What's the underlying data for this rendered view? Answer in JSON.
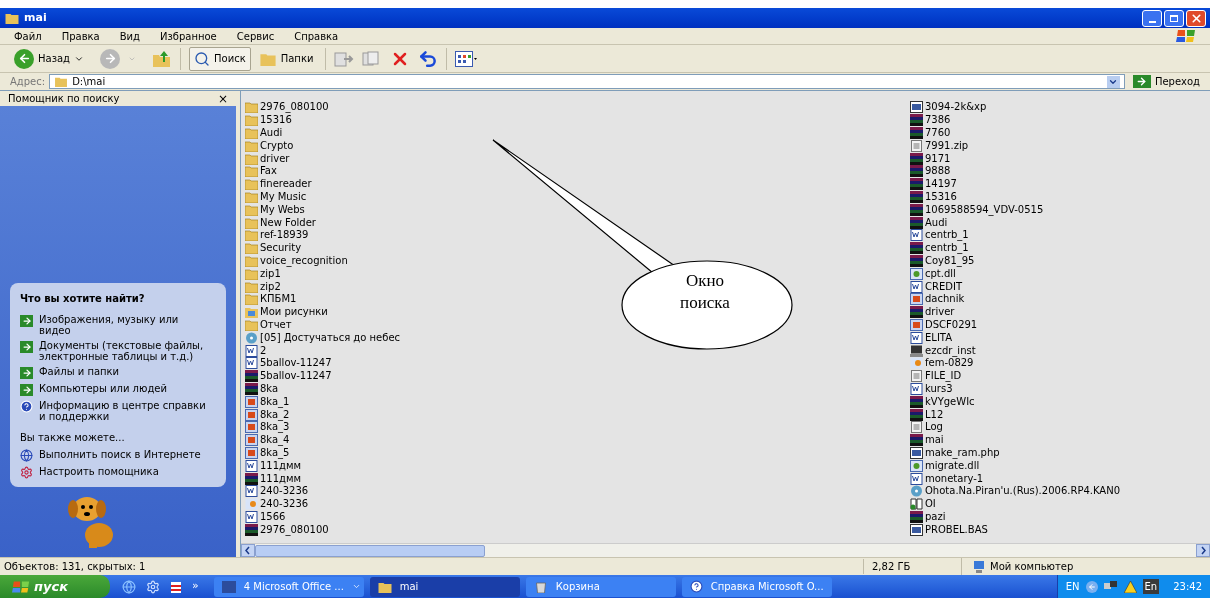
{
  "window": {
    "title": "mai"
  },
  "menu": [
    "Файл",
    "Правка",
    "Вид",
    "Избранное",
    "Сервис",
    "Справка"
  ],
  "toolbar": {
    "back": "Назад",
    "search": {
      "label": "Поиск",
      "selected": true
    },
    "folders": {
      "label": "Папки",
      "selected": false
    }
  },
  "address": {
    "label": "Адрес:",
    "value": "D:\\mai",
    "go": "Переход"
  },
  "search_pane": {
    "title": "Помощник по поиску",
    "close": "×",
    "heading": "Что вы хотите найти?",
    "options": [
      {
        "kind": "arrow",
        "label": "Изображения, музыку или видео"
      },
      {
        "kind": "arrow",
        "label": "Документы (текстовые файлы, электронные таблицы и т.д.)"
      },
      {
        "kind": "arrow",
        "label": "Файлы и папки"
      },
      {
        "kind": "arrow",
        "label": "Компьютеры или людей"
      },
      {
        "kind": "help",
        "label": "Информацию в центре справки и поддержки"
      }
    ],
    "also_heading": "Вы также можете...",
    "also": [
      {
        "kind": "web",
        "label": "Выполнить поиск в Интернете"
      },
      {
        "kind": "settings",
        "label": "Настроить помощника"
      }
    ]
  },
  "files": {
    "column_1": [
      {
        "kind": "folder",
        "name": "2976_080100"
      },
      {
        "kind": "folder",
        "name": "15316"
      },
      {
        "kind": "folder",
        "name": "Audi"
      },
      {
        "kind": "folder",
        "name": "Crypto"
      },
      {
        "kind": "folder",
        "name": "driver"
      },
      {
        "kind": "folder",
        "name": "Fax"
      },
      {
        "kind": "folder",
        "name": "finereader"
      },
      {
        "kind": "folder",
        "name": "My Music"
      },
      {
        "kind": "folder",
        "name": "My Webs"
      },
      {
        "kind": "folder",
        "name": "New Folder"
      },
      {
        "kind": "folder",
        "name": "ref-18939"
      },
      {
        "kind": "folder",
        "name": "Security"
      },
      {
        "kind": "folder",
        "name": "voice_recognition"
      },
      {
        "kind": "folder",
        "name": "zip1"
      },
      {
        "kind": "folder",
        "name": "zip2"
      },
      {
        "kind": "folder",
        "name": "КПБМ1"
      },
      {
        "kind": "pictures",
        "name": "Мои рисунки"
      },
      {
        "kind": "folder",
        "name": "Отчет"
      },
      {
        "kind": "media",
        "name": "[05] Достучаться до небес"
      },
      {
        "kind": "word",
        "name": "2"
      },
      {
        "kind": "word",
        "name": "5ballov-11247"
      },
      {
        "kind": "archive",
        "name": "5ballov-11247"
      },
      {
        "kind": "archive",
        "name": "8ka"
      },
      {
        "kind": "image",
        "name": "8ka_1"
      },
      {
        "kind": "image",
        "name": "8ka_2"
      },
      {
        "kind": "image",
        "name": "8ka_3"
      },
      {
        "kind": "image",
        "name": "8ka_4"
      },
      {
        "kind": "image",
        "name": "8ka_5"
      },
      {
        "kind": "word",
        "name": "111дмм"
      },
      {
        "kind": "archive",
        "name": "111дмм"
      },
      {
        "kind": "word",
        "name": "240-3236"
      },
      {
        "kind": "shortcut",
        "name": "240-3236"
      },
      {
        "kind": "word",
        "name": "1566"
      },
      {
        "kind": "archive",
        "name": "2976_080100"
      }
    ],
    "column_2": [
      {
        "kind": "program",
        "name": "3094-2k&xp"
      },
      {
        "kind": "archive",
        "name": "7386"
      },
      {
        "kind": "archive",
        "name": "7760"
      },
      {
        "kind": "text",
        "name": "7991.zip"
      },
      {
        "kind": "archive",
        "name": "9171"
      },
      {
        "kind": "archive",
        "name": "9888"
      },
      {
        "kind": "archive",
        "name": "14197"
      },
      {
        "kind": "archive",
        "name": "15316"
      },
      {
        "kind": "archive",
        "name": "1069588594_VDV-0515"
      },
      {
        "kind": "archive",
        "name": "Audi"
      },
      {
        "kind": "word",
        "name": "centrb_1"
      },
      {
        "kind": "archive",
        "name": "centrb_1"
      },
      {
        "kind": "archive",
        "name": "Coy81_95"
      },
      {
        "kind": "dll",
        "name": "cpt.dll"
      },
      {
        "kind": "word",
        "name": "CREDIT"
      },
      {
        "kind": "image",
        "name": "dachnik"
      },
      {
        "kind": "archive",
        "name": "driver"
      },
      {
        "kind": "image",
        "name": "DSCF0291"
      },
      {
        "kind": "word",
        "name": "ELITA"
      },
      {
        "kind": "installer",
        "name": "ezcdr_inst"
      },
      {
        "kind": "shortcut",
        "name": "fem-0829"
      },
      {
        "kind": "text",
        "name": "FILE_ID"
      },
      {
        "kind": "word",
        "name": "kurs3"
      },
      {
        "kind": "archive",
        "name": "kVYgeWIc"
      },
      {
        "kind": "archive",
        "name": "L12"
      },
      {
        "kind": "text",
        "name": "Log"
      },
      {
        "kind": "archive",
        "name": "mai"
      },
      {
        "kind": "program",
        "name": "make_ram.php"
      },
      {
        "kind": "dll",
        "name": "migrate.dll"
      },
      {
        "kind": "word",
        "name": "monetary-1"
      },
      {
        "kind": "media",
        "name": "Ohota.Na.Piran'u.(Rus).2006.RP4.KAN0"
      },
      {
        "kind": "book",
        "name": "OI"
      },
      {
        "kind": "archive",
        "name": "pazi"
      },
      {
        "kind": "program",
        "name": "PROBEL.BAS"
      }
    ]
  },
  "callout": "Окно поиска",
  "status_bar": {
    "objects": "Объектов: 131, скрытых: 1",
    "size": "2,82 ГБ",
    "location": "Мой компьютер"
  },
  "taskbar": {
    "start": "пуск",
    "overflow": "»",
    "tasks": [
      {
        "kind": "word",
        "label": "4 Microsoft Office ...",
        "group": true,
        "selected": false
      },
      {
        "kind": "folder",
        "label": "mai",
        "group": false,
        "selected": true
      },
      {
        "kind": "recycle",
        "label": "Корзина",
        "group": false,
        "selected": false
      },
      {
        "kind": "help",
        "label": "Справка Microsoft O...",
        "group": false,
        "selected": false
      }
    ],
    "language": "EN",
    "input": "En",
    "clock": "23:42"
  }
}
